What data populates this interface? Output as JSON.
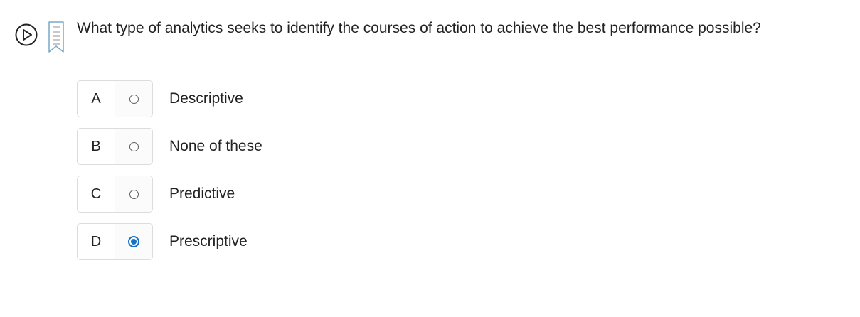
{
  "question": {
    "text": "What type of analytics seeks to identify the courses of action to achieve the best performance possible?"
  },
  "controls": {
    "play_icon": "play-circle-icon",
    "bookmark_icon": "bookmark-icon"
  },
  "options": [
    {
      "letter": "A",
      "label": "Descriptive",
      "selected": false
    },
    {
      "letter": "B",
      "label": "None of these",
      "selected": false
    },
    {
      "letter": "C",
      "label": "Predictive",
      "selected": false
    },
    {
      "letter": "D",
      "label": "Prescriptive",
      "selected": true
    }
  ],
  "colors": {
    "accent": "#1570c8",
    "border": "#dcdcdc",
    "text": "#222222",
    "bookmark": "#7aa7c7"
  }
}
